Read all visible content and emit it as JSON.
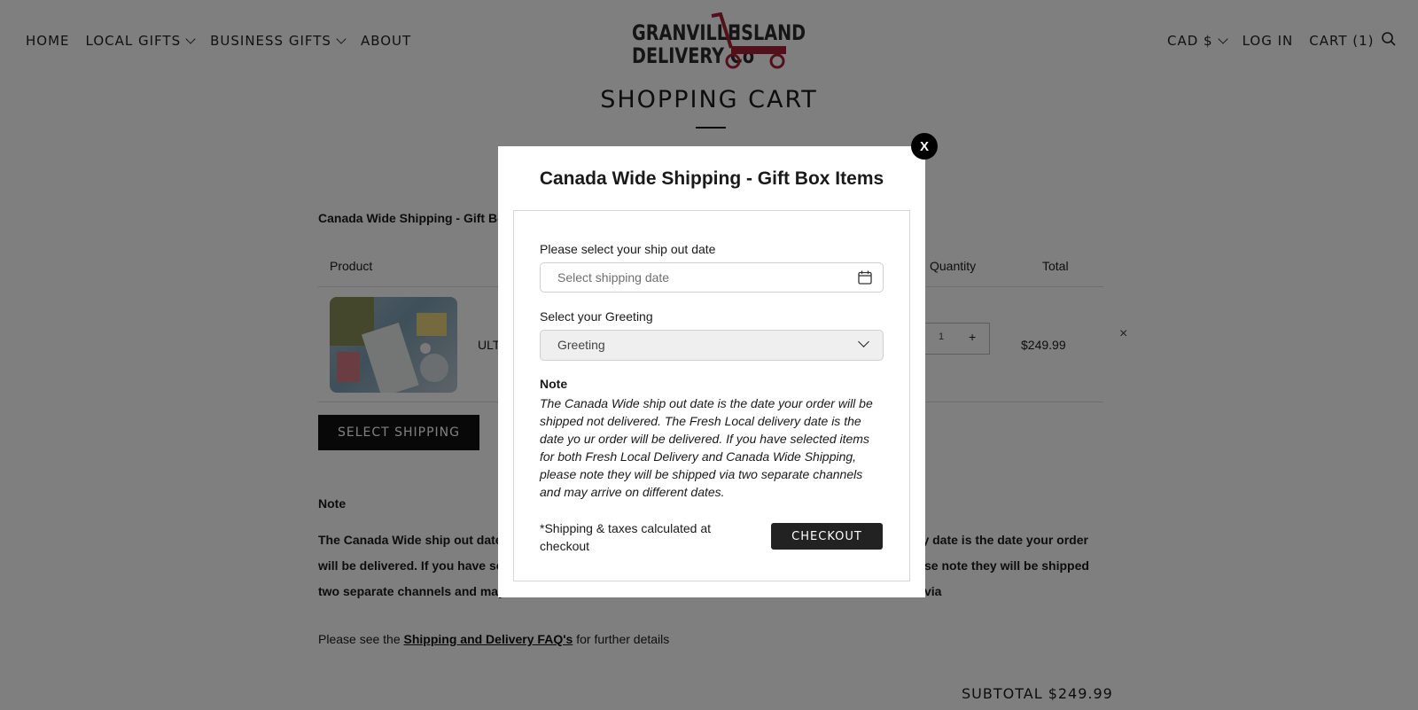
{
  "header": {
    "nav_left": [
      "HOME",
      "LOCAL GIFTS",
      "BUSINESS GIFTS",
      "ABOUT"
    ],
    "logo_line1_left": "GRANVILLE",
    "logo_line1_right": "ISLAND",
    "logo_line2": "DELIVERY Co",
    "currency": "CAD $",
    "login": "LOG IN",
    "cart": "CART (1)",
    "icons": {
      "search": "search-icon",
      "dropdown": "chevron-down-icon"
    },
    "logo_accent_color": "#a32035"
  },
  "page": {
    "title": "SHOPPING CART",
    "section_heading": "Canada Wide Shipping - Gift Bo",
    "table": {
      "columns": [
        "Product",
        "Quantity",
        "Total"
      ],
      "rows": [
        {
          "name": "ULT",
          "quantity": "1",
          "plus": "+",
          "total": "$249.99",
          "remove": "×"
        }
      ]
    },
    "select_shipping": "SELECT SHIPPING",
    "note_heading": "Note",
    "note_lines": [
      "The Canada Wide ship out date",
      "ry date is the date your order",
      "will be delivered. If you have se",
      "se note they will be shipped via",
      "two separate channels and may"
    ],
    "faq_prefix": "Please see the ",
    "faq_link": "Shipping and Delivery FAQ's",
    "faq_suffix": " for further details",
    "subtotal": "SUBTOTAL $249.99"
  },
  "modal": {
    "close": "X",
    "title": "Canada Wide Shipping - Gift Box Items",
    "ship_date_label": "Please select your ship out date",
    "ship_date_placeholder": "Select shipping date",
    "greeting_label": "Select your Greeting",
    "greeting_value": "Greeting",
    "note_heading": "Note",
    "note_text": "The Canada Wide ship out date is the date your order will be shipped not delivered. The Fresh Local delivery date is the date yo ur order will be delivered. If you have selected items for both Fresh Local Delivery and Canada Wide Shipping, please note they will be shipped via two separate channels and may arrive on different dates.",
    "shipping_taxes": "*Shipping & taxes calculated at checkout",
    "checkout": "CHECKOUT",
    "icons": {
      "calendar": "calendar-icon",
      "select": "chevron-down-icon",
      "close": "close-icon"
    }
  }
}
